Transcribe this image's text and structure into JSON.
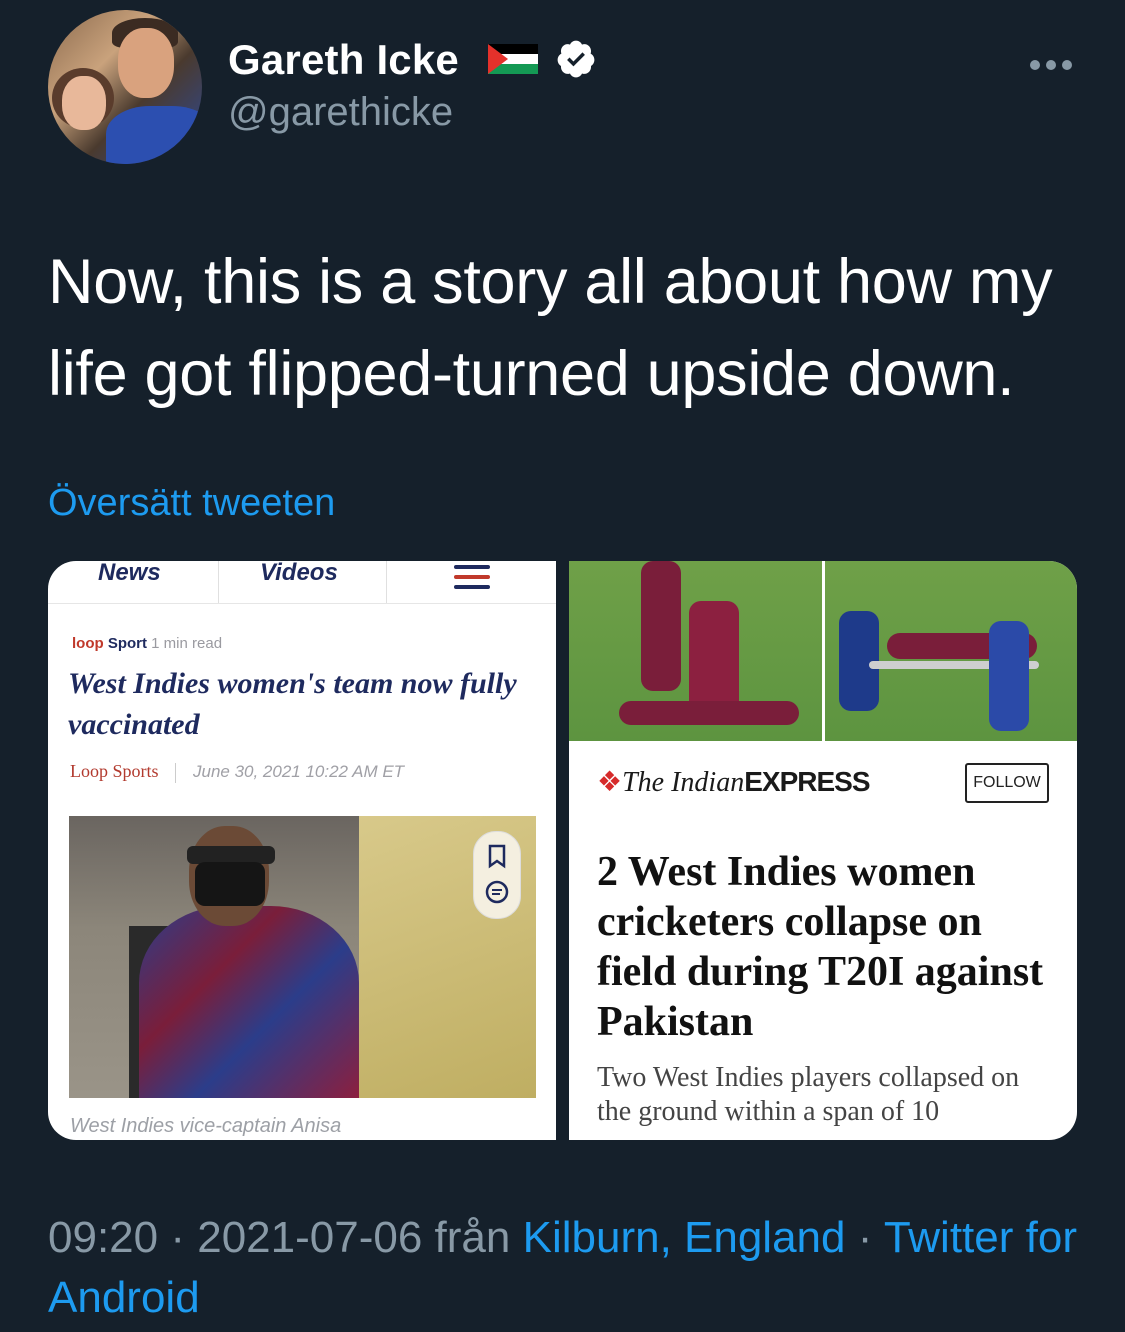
{
  "author": {
    "name": "Gareth Icke",
    "handle": "@garethicke",
    "flag_icon": "palestine-flag-icon",
    "verified_icon": "verified-badge-icon"
  },
  "tweet": {
    "text": "Now, this is a story all about how my life got flipped-turned upside down.",
    "translate_label": "Översätt tweeten"
  },
  "media": {
    "left_card": {
      "nav_tabs": [
        "News",
        "Videos"
      ],
      "source_brand": "loop",
      "source_section": "Sport",
      "read_time": "1 min read",
      "headline": "West Indies women's team now fully vaccinated",
      "byline_source": "Loop Sports",
      "byline_date": "June 30, 2021 10:22 AM ET",
      "photo_caption": "West Indies vice-captain Anisa"
    },
    "right_card": {
      "publisher_prefix": "The Indian",
      "publisher_suffix": "EXPRESS",
      "follow_label": "FOLLOW",
      "headline": "2 West Indies women cricketers collapse on field during T20I against Pakistan",
      "description": "Two West Indies players collapsed on the ground within a span of 10"
    }
  },
  "footer": {
    "time": "09:20",
    "separator": "·",
    "date": "2021-07-06",
    "from_label": "från",
    "location": "Kilburn, England",
    "client": "Twitter for Android"
  },
  "colors": {
    "background": "#15202b",
    "link": "#1d9bf0",
    "secondary_text": "#8899a6"
  }
}
